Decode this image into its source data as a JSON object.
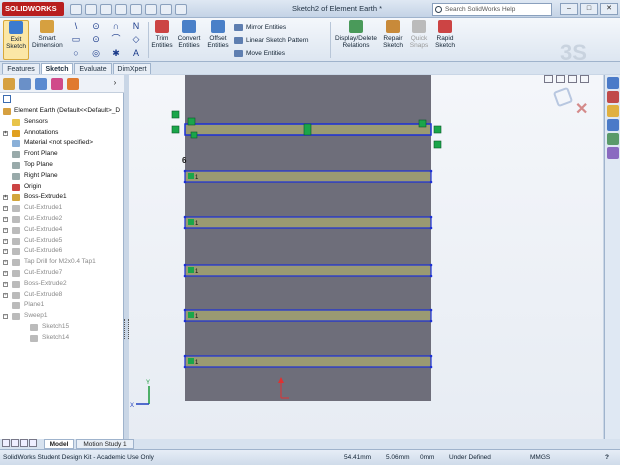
{
  "app": {
    "logo": "SOLIDWORKS",
    "doc_title": "Sketch2 of Element Earth *",
    "search_placeholder": "Search SolidWorks Help",
    "win_min": "–",
    "win_max": "□",
    "win_close": "✕"
  },
  "ribbon": {
    "exit_sketch": "Exit Sketch",
    "smart_dimension": "Smart Dimension",
    "trim_entities": "Trim Entities",
    "convert_entities": "Convert Entities",
    "offset_entities": "Offset Entities",
    "mirror_entities": "Mirror Entities",
    "linear_pattern": "Linear Sketch Pattern",
    "move_entities": "Move Entities",
    "display_relations": "Display/Delete Relations",
    "repair_sketch": "Repair Sketch",
    "quick_snaps": "Quick Snaps",
    "rapid_sketch": "Rapid Sketch",
    "sketch_tools": [
      "\\",
      "⊙",
      "∩",
      "N",
      "▭",
      "⊙",
      "⌒",
      "◇",
      "○",
      "◎",
      "✱",
      "A"
    ]
  },
  "tabs": [
    "Features",
    "Sketch",
    "Evaluate",
    "DimXpert"
  ],
  "tree": {
    "root": "Element Earth  (Default<<Default>_D",
    "items": [
      {
        "label": "Sensors",
        "icon": "sensors-icon",
        "exp": "",
        "dim": false,
        "color": "#e8c44a"
      },
      {
        "label": "Annotations",
        "icon": "annotations-icon",
        "exp": "+",
        "dim": false,
        "color": "#e0a020"
      },
      {
        "label": "Material <not specified>",
        "icon": "material-icon",
        "exp": "",
        "dim": false,
        "color": "#8ab0d8"
      },
      {
        "label": "Front Plane",
        "icon": "plane-icon",
        "exp": "",
        "dim": false,
        "color": "#9aa"
      },
      {
        "label": "Top Plane",
        "icon": "plane-icon",
        "exp": "",
        "dim": false,
        "color": "#9aa"
      },
      {
        "label": "Right Plane",
        "icon": "plane-icon",
        "exp": "",
        "dim": false,
        "color": "#9aa"
      },
      {
        "label": "Origin",
        "icon": "origin-icon",
        "exp": "",
        "dim": false,
        "color": "#c44"
      },
      {
        "label": "Boss-Extrude1",
        "icon": "extrude-icon",
        "exp": "+",
        "dim": false,
        "color": "#d2a53c"
      },
      {
        "label": "Cut-Extrude1",
        "icon": "cut-icon",
        "exp": "+",
        "dim": true,
        "color": "#bbb"
      },
      {
        "label": "Cut-Extrude2",
        "icon": "cut-icon",
        "exp": "+",
        "dim": true,
        "color": "#bbb"
      },
      {
        "label": "Cut-Extrude4",
        "icon": "cut-icon",
        "exp": "+",
        "dim": true,
        "color": "#bbb"
      },
      {
        "label": "Cut-Extrude5",
        "icon": "cut-icon",
        "exp": "+",
        "dim": true,
        "color": "#bbb"
      },
      {
        "label": "Cut-Extrude6",
        "icon": "cut-icon",
        "exp": "+",
        "dim": true,
        "color": "#bbb"
      },
      {
        "label": "Tap Drill for M2x0.4 Tap1",
        "icon": "hole-icon",
        "exp": "+",
        "dim": true,
        "color": "#bbb"
      },
      {
        "label": "Cut-Extrude7",
        "icon": "cut-icon",
        "exp": "+",
        "dim": true,
        "color": "#bbb"
      },
      {
        "label": "Boss-Extrude2",
        "icon": "extrude-icon",
        "exp": "+",
        "dim": true,
        "color": "#bbb"
      },
      {
        "label": "Cut-Extrude8",
        "icon": "cut-icon",
        "exp": "+",
        "dim": true,
        "color": "#bbb"
      },
      {
        "label": "Plane1",
        "icon": "plane-icon",
        "exp": "",
        "dim": true,
        "color": "#bbb"
      },
      {
        "label": "Sweep1",
        "icon": "sweep-icon",
        "exp": "−",
        "dim": true,
        "color": "#bbb"
      },
      {
        "label": "Sketch15",
        "icon": "sketch-icon",
        "exp": "",
        "dim": true,
        "color": "#bbb",
        "indent": true
      },
      {
        "label": "Sketch14",
        "icon": "sketch-icon",
        "exp": "",
        "dim": true,
        "color": "#bbb",
        "indent": true
      }
    ]
  },
  "sketch": {
    "dimension_label": "6",
    "relation_label": "1",
    "colors": {
      "body": "#6e6e7a",
      "slot": "#9a9a72",
      "line": "#1b2fd6",
      "relation": "#1aa64a"
    }
  },
  "bottom_tabs": [
    "Model",
    "Motion Study 1"
  ],
  "status": {
    "license": "SolidWorks Student Design Kit - Academic Use Only",
    "x": "54.41mm",
    "y": "5.06mm",
    "z": "0mm",
    "state": "Under Defined",
    "units": "MMGS",
    "help": "?"
  }
}
